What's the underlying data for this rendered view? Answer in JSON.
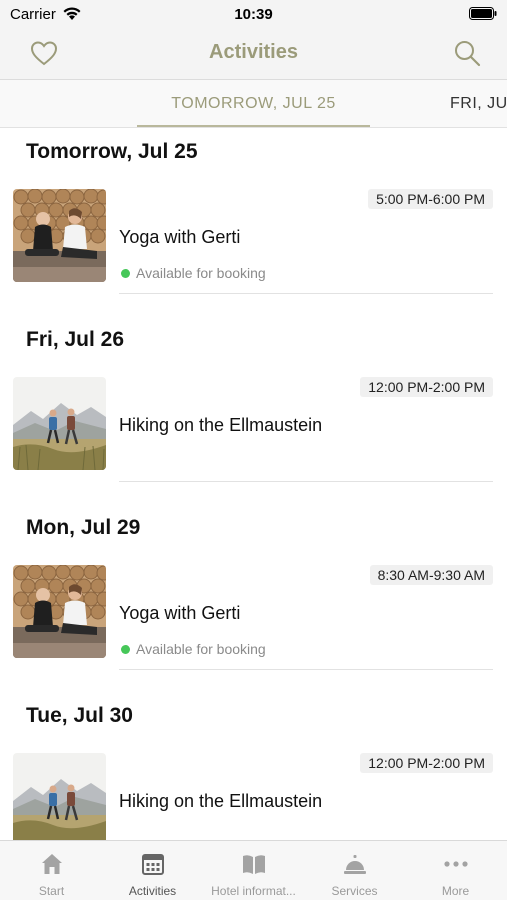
{
  "status_bar": {
    "carrier": "Carrier",
    "time": "10:39"
  },
  "nav": {
    "title": "Activities"
  },
  "tabs": [
    {
      "label": "TOMORROW, JUL 25",
      "active": true
    },
    {
      "label": "FRI, JU",
      "active": false
    }
  ],
  "days": [
    {
      "header": "Tomorrow, Jul 25",
      "activity": {
        "time": "5:00 PM-6:00 PM",
        "title": "Yoga with Gerti",
        "availability": "Available for booking",
        "image": "yoga"
      }
    },
    {
      "header": "Fri, Jul 26",
      "activity": {
        "time": "12:00 PM-2:00 PM",
        "title": "Hiking on the Ellmaustein",
        "availability": "",
        "image": "hiking"
      }
    },
    {
      "header": "Mon, Jul 29",
      "activity": {
        "time": "8:30 AM-9:30 AM",
        "title": "Yoga with Gerti",
        "availability": "Available for booking",
        "image": "yoga"
      }
    },
    {
      "header": "Tue, Jul 30",
      "activity": {
        "time": "12:00 PM-2:00 PM",
        "title": "Hiking on the Ellmaustein",
        "availability": "",
        "image": "hiking"
      }
    }
  ],
  "tab_bar": [
    {
      "label": "Start",
      "icon": "house-icon",
      "active": false
    },
    {
      "label": "Activities",
      "icon": "calendar-icon",
      "active": true
    },
    {
      "label": "Hotel informat...",
      "icon": "book-icon",
      "active": false
    },
    {
      "label": "Services",
      "icon": "service-bell-icon",
      "active": false
    },
    {
      "label": "More",
      "icon": "more-dots-icon",
      "active": false
    }
  ],
  "colors": {
    "accent": "#9b9b7a",
    "available_dot": "#46c759",
    "tab_underline": "#b9b89c"
  }
}
